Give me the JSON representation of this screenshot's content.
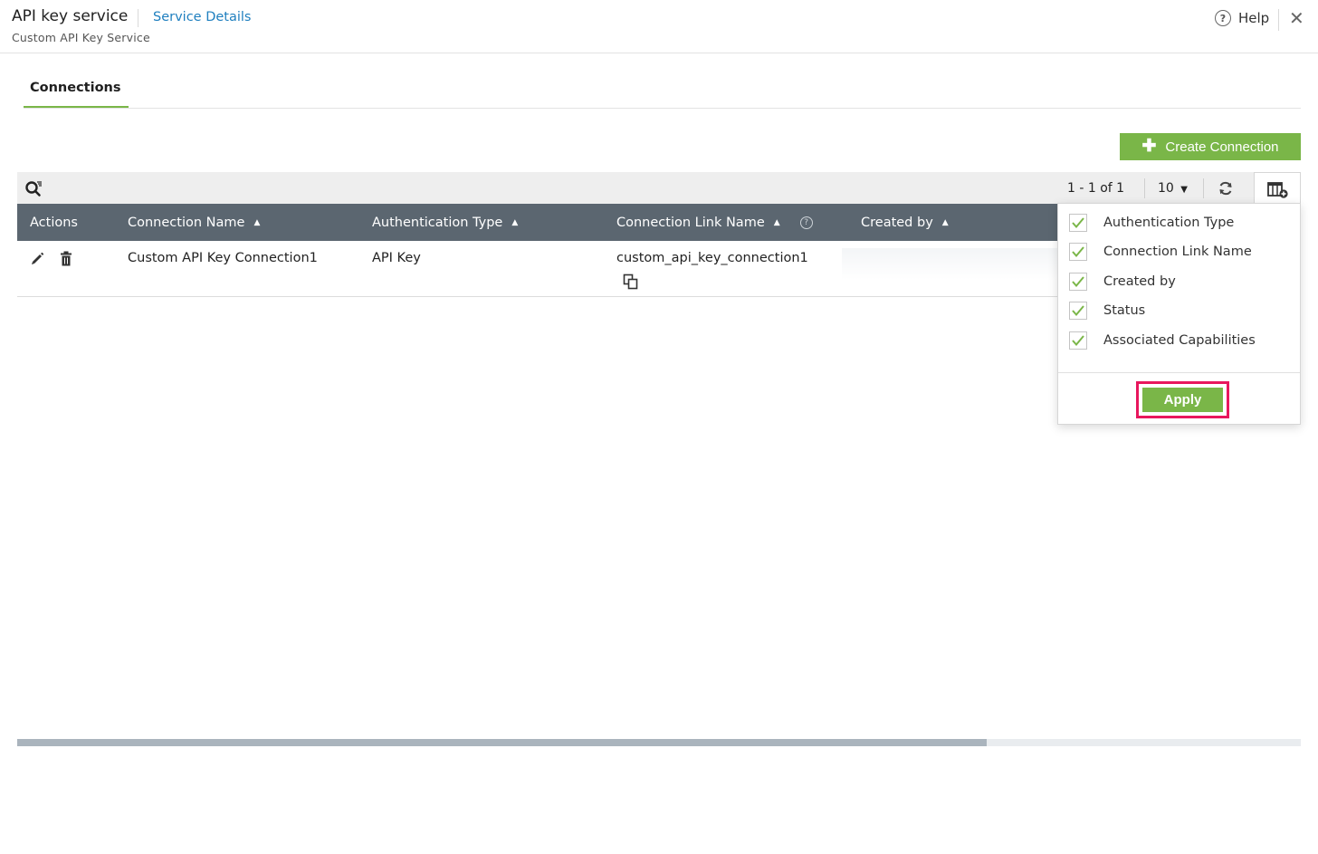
{
  "header": {
    "title": "API key service",
    "service_link": "Service Details",
    "subtitle": "Custom API Key Service",
    "help_label": "Help"
  },
  "tabs": [
    {
      "label": "Connections",
      "active": true
    }
  ],
  "toolbar": {
    "create_label": "Create Connection",
    "pager_text": "1 - 1 of 1",
    "per_page": "10"
  },
  "table": {
    "columns": [
      "Actions",
      "Connection Name",
      "Authentication Type",
      "Connection Link Name",
      "Created by"
    ],
    "rows": [
      {
        "connection_name": "Custom API Key Connection1",
        "auth_type": "API Key",
        "link_name": "custom_api_key_connection1",
        "created_by": ""
      }
    ]
  },
  "column_chooser": {
    "options": [
      {
        "label": "Authentication Type",
        "checked": true
      },
      {
        "label": "Connection Link Name",
        "checked": true
      },
      {
        "label": "Created by",
        "checked": true
      },
      {
        "label": "Status",
        "checked": true
      },
      {
        "label": "Associated Capabilities",
        "checked": true
      }
    ],
    "apply_label": "Apply"
  },
  "colors": {
    "accent_green": "#7ab648",
    "link_blue": "#1f7fbf",
    "table_header": "#5b6670",
    "highlight": "#e8175d"
  },
  "icons": [
    "help-icon",
    "close-icon",
    "plus-icon",
    "search-filter-icon",
    "caret-down-icon",
    "refresh-icon",
    "column-settings-icon",
    "sort-asc-icon",
    "info-icon",
    "edit-icon",
    "trash-icon",
    "copy-icon",
    "check-icon"
  ]
}
